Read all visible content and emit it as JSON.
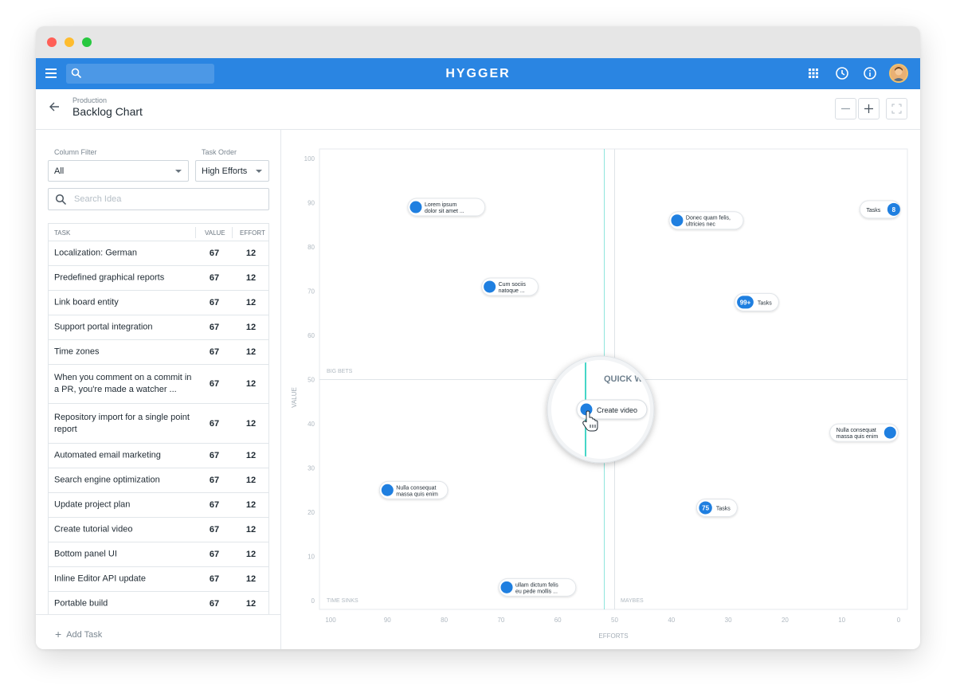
{
  "app": {
    "brand": "HYGGER"
  },
  "header": {
    "breadcrumb": "Production",
    "title": "Backlog Chart"
  },
  "sidebar": {
    "column_filter_label": "Column Filter",
    "column_filter_value": "All",
    "task_order_label": "Task Order",
    "task_order_value": "High Efforts",
    "search_placeholder": "Search Idea",
    "columns": {
      "task": "TASK",
      "value": "VALUE",
      "effort": "EFFORT"
    },
    "rows": [
      {
        "task": "Localization: German",
        "value": "67",
        "effort": "12"
      },
      {
        "task": "Predefined graphical reports",
        "value": "67",
        "effort": "12"
      },
      {
        "task": "Link board entity",
        "value": "67",
        "effort": "12"
      },
      {
        "task": "Support portal integration",
        "value": "67",
        "effort": "12"
      },
      {
        "task": "Time zones",
        "value": "67",
        "effort": "12"
      },
      {
        "task": "When you comment on a commit in a PR, you're made a watcher ...",
        "value": "67",
        "effort": "12"
      },
      {
        "task": "Repository import for a single point report",
        "value": "67",
        "effort": "12"
      },
      {
        "task": "Automated email marketing",
        "value": "67",
        "effort": "12"
      },
      {
        "task": "Search engine optimization",
        "value": "67",
        "effort": "12"
      },
      {
        "task": "Update project plan",
        "value": "67",
        "effort": "12"
      },
      {
        "task": "Create tutorial video",
        "value": "67",
        "effort": "12"
      },
      {
        "task": "Bottom panel UI",
        "value": "67",
        "effort": "12"
      },
      {
        "task": "Inline Editor API update",
        "value": "67",
        "effort": "12"
      },
      {
        "task": "Portable build",
        "value": "67",
        "effort": "12"
      }
    ],
    "add_task_label": "Add Task"
  },
  "chart_data": {
    "type": "scatter",
    "xlabel": "EFFORTS",
    "ylabel": "VALUE",
    "xlim": [
      100,
      0
    ],
    "ylim": [
      0,
      100
    ],
    "x_ticks": [
      "100",
      "90",
      "80",
      "70",
      "60",
      "50",
      "40",
      "30",
      "20",
      "10",
      "0"
    ],
    "y_ticks": [
      "100",
      "90",
      "80",
      "70",
      "60",
      "50",
      "40",
      "30",
      "20",
      "10",
      "0"
    ],
    "threshold_x": 50,
    "threshold_y": 50,
    "quadrants": {
      "top_left": "BIG BETS",
      "top_right": "QUICK WINS",
      "bottom_left": "TIME SINKS",
      "bottom_right": "MAYBES"
    },
    "points": [
      {
        "label": "Lorem ipsum dolor sit amet ...",
        "label_lines": [
          "Lorem ipsum",
          "dolor sit amet ..."
        ],
        "x": 85,
        "y": 89
      },
      {
        "label": "Donec quam felis, ultricies nec",
        "label_lines": [
          "Donec quam felis,",
          "ultricies nec"
        ],
        "x": 39,
        "y": 86
      },
      {
        "label": "Tasks",
        "count": "8",
        "x": 1,
        "y": 88.5
      },
      {
        "label": "Cum sociis natoque ...",
        "label_lines": [
          "Cum sociis",
          "natoque ..."
        ],
        "x": 72,
        "y": 71
      },
      {
        "label": "Tasks",
        "count": "99+",
        "x": 27,
        "y": 67.5
      },
      {
        "label": "Create video",
        "x": 54,
        "y": 43
      },
      {
        "label": "Tasks",
        "count": "4",
        "x": 57,
        "y": 38
      },
      {
        "label": "Nulla consequat massa quis enim",
        "label_lines": [
          "Nulla consequat",
          "massa quis enim"
        ],
        "x": 1.5,
        "y": 38
      },
      {
        "label": "Nulla consequat massa quis enim",
        "label_lines": [
          "Nulla consequat",
          "massa quis enim"
        ],
        "x": 90,
        "y": 25
      },
      {
        "label": "Tasks",
        "count": "75",
        "x": 34,
        "y": 21
      },
      {
        "label": "ullam dictum felis eu pede mollis ...",
        "label_lines": [
          "ullam dictum felis",
          "eu pede mollis ..."
        ],
        "x": 69,
        "y": 3
      }
    ],
    "magnifier": {
      "label": "QUICK WINS",
      "point_label": "Create video"
    }
  },
  "colors": {
    "brand": "#2a85e2",
    "point": "#1f7fe0",
    "threshold": "#45d6c7"
  }
}
